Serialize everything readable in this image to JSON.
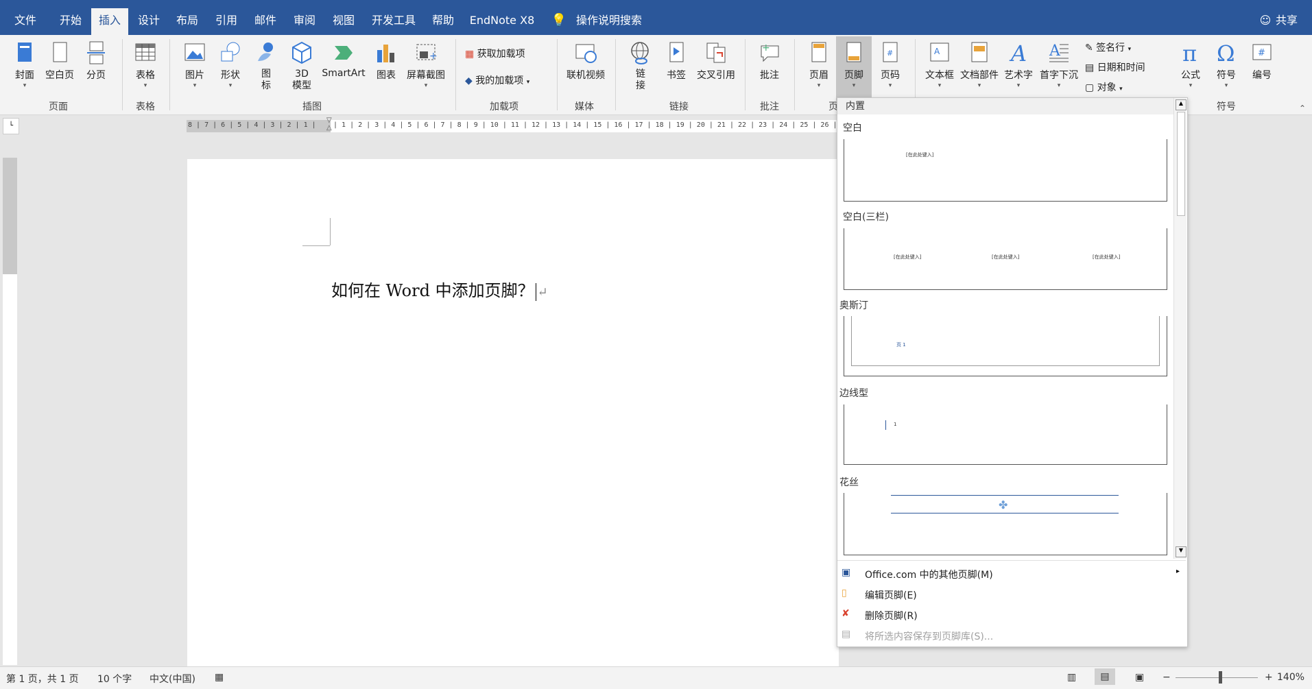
{
  "tabs": {
    "file": "文件",
    "home": "开始",
    "insert": "插入",
    "design": "设计",
    "layout": "布局",
    "references": "引用",
    "mailings": "邮件",
    "review": "审阅",
    "view": "视图",
    "developer": "开发工具",
    "help": "帮助",
    "endnote": "EndNote X8",
    "search": "操作说明搜索",
    "share": "共享"
  },
  "ribbon": {
    "cover": "封面",
    "blank_page": "空白页",
    "page_break": "分页",
    "group_pages": "页面",
    "table": "表格",
    "group_tables": "表格",
    "pictures": "图片",
    "shapes": "形状",
    "icons_line1": "图",
    "icons_line2": "标",
    "model_line1": "3D",
    "model_line2": "模型",
    "smartart": "SmartArt",
    "chart": "图表",
    "screenshot": "屏幕截图",
    "group_illustrations": "插图",
    "get_addins": "获取加载项",
    "my_addins": "我的加载项",
    "group_addins": "加载项",
    "online_video": "联机视频",
    "group_media": "媒体",
    "link_line1": "链",
    "link_line2": "接",
    "bookmark": "书签",
    "cross_ref": "交叉引用",
    "group_links": "链接",
    "comment": "批注",
    "group_comments": "批注",
    "header": "页眉",
    "footer": "页脚",
    "page_number": "页码",
    "group_header_footer": "页",
    "textbox": "文本框",
    "quick_parts": "文档部件",
    "wordart": "艺术字",
    "dropcap": "首字下沉",
    "signature_line": "签名行",
    "date_time": "日期和时间",
    "object": "对象",
    "equation": "公式",
    "symbol": "符号",
    "number": "编号",
    "group_symbols": "符号"
  },
  "document": {
    "text": "如何在 Word 中添加页脚？",
    "mark": "↵"
  },
  "ruler": {
    "left": "8 | 7 | 6 | 5 | 4 | 3 | 2 | 1 |",
    "right": "| 1 | 2 | 3 | 4 | 5 | 6 | 7 | 8 | 9 | 10 | 11 | 12 | 13 | 14 | 15 | 16 | 17 | 18 | 19 | 20 | 21 | 22 | 23 | 24 | 25 | 26 | 27 | 28 |"
  },
  "gallery": {
    "section": "内置",
    "items": [
      {
        "name": "空白",
        "placeholders": [
          "[在此处键入]"
        ]
      },
      {
        "name": "空白(三栏)",
        "placeholders": [
          "[在此处键入]",
          "[在此处键入]",
          "[在此处键入]"
        ]
      },
      {
        "name": "奥斯汀",
        "placeholders": [
          "页 1"
        ]
      },
      {
        "name": "边线型",
        "placeholders": [
          "1"
        ]
      },
      {
        "name": "花丝",
        "placeholders": []
      }
    ],
    "menu": {
      "more": "Office.com 中的其他页脚(M)",
      "edit": "编辑页脚(E)",
      "remove": "删除页脚(R)",
      "save": "将所选内容保存到页脚库(S)..."
    }
  },
  "status": {
    "page": "第 1 页，共 1 页",
    "words": "10 个字",
    "language": "中文(中国)",
    "zoom": "140%"
  },
  "colors": {
    "brand": "#2b579a",
    "ribbon": "#f3f3f3"
  }
}
